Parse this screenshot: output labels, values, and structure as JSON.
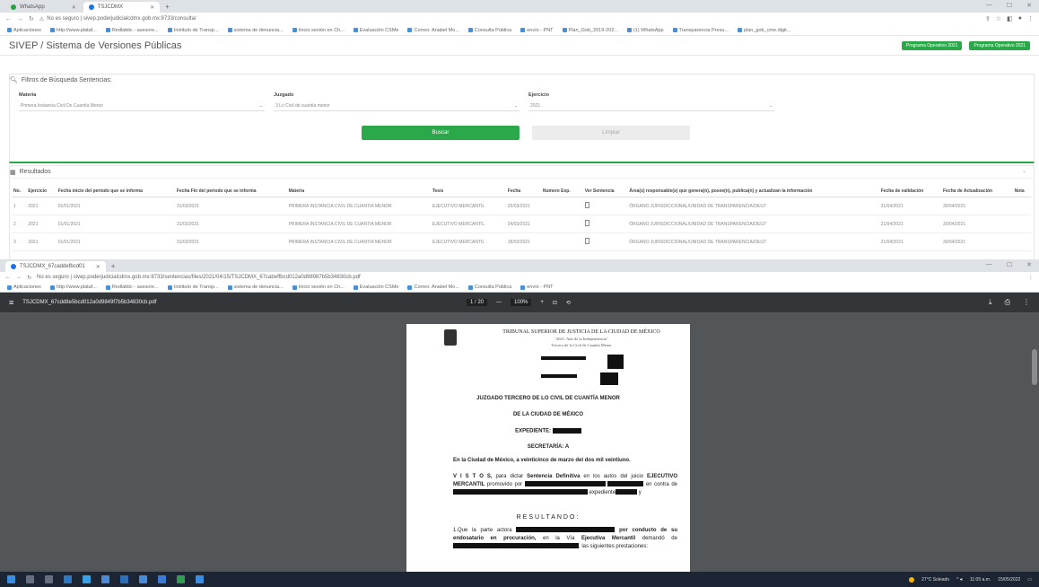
{
  "browser1": {
    "tabs": [
      {
        "label": "WhatsApp"
      },
      {
        "label": "TSJCDMX"
      }
    ],
    "url": "No es seguro | sivep.poderjudicialcdmx.gob.mx:8733/consulta/",
    "bookmarks": [
      "Aplicaciones",
      "http://www.plataf...",
      "Redlabtic - asesore...",
      "Instituto de Transp...",
      "sistema de denuncia...",
      "Inicio sesión en Ch...",
      "Evaluación CSMe",
      "Correo: Anabel Mo...",
      "Consulta Pública",
      "envío - PNT",
      "Plan_Gob_2019-202...",
      "(1) WhatsApp",
      "Transparencia Presu...",
      "plan_gob_cme.digit..."
    ]
  },
  "app": {
    "title": "SIVEP / Sistema de Versiones Públicas",
    "header_buttons": [
      "Programa Operativo 2021",
      "Programa Operativo 2021"
    ],
    "filters_title": "Filtros de Búsqueda Sentencias:",
    "fields": [
      {
        "label": "Materia",
        "value": "Primera Instancia Civil De Cuantía Menor"
      },
      {
        "label": "Juzgado",
        "value": "3 Lo Civil de cuantía menor"
      },
      {
        "label": "Ejercicio",
        "value": "2021"
      }
    ],
    "search_label": "Buscar",
    "clear_label": "Limpiar",
    "results_title": "Resultados",
    "columns": [
      "No.",
      "Ejercicio",
      "Fecha inicio del periodo que se informa",
      "Fecha Fin del periodo que se informa",
      "Materia",
      "Tesis",
      "Fecha",
      "Numero Exp.",
      "Ver Sentencia",
      "Área(s) responsable(s) que genera(n), posee(n), publica(n) y actualizan la información",
      "Fecha de validación",
      "Fecha de Actualización",
      "Nota"
    ],
    "rows": [
      [
        "1",
        "2021",
        "01/01/2021",
        "31/03/2021",
        "PRIMERA INSTANCIA CIVIL DE CUANTIA MENOR",
        "EJECUTIVO MERCANTIL",
        "25/03/2021",
        "",
        "",
        "ÓRGANO JURISDICCIONAL/UNIDAD DE TRANSPARENCIA/DEGT",
        "31/04/2021",
        "30/04/2021",
        ""
      ],
      [
        "2",
        "2021",
        "01/01/2021",
        "31/03/2021",
        "PRIMERA INSTANCIA CIVIL DE CUANTIA MENOR",
        "EJECUTIVO MERCANTIL",
        "24/03/2021",
        "",
        "",
        "ÓRGANO JURISDICCIONAL/UNIDAD DE TRANSPARENCIA/DEGT",
        "21/04/2021",
        "30/04/2021",
        ""
      ],
      [
        "3",
        "2021",
        "01/01/2021",
        "31/03/2021",
        "PRIMERA INSTANCIA CIVIL DE CUANTIA MENOR",
        "EJECUTIVO MERCANTIL",
        "18/03/2021",
        "",
        "",
        "ÓRGANO JURISDICCIONAL/UNIDAD DE TRANSPARENCIA/DEGT",
        "21/04/2021",
        "30/04/2021",
        ""
      ]
    ]
  },
  "browser2": {
    "tab_label": "TSJCDMX_67caddefbcd01",
    "url": "No es seguro | sivep.poderjudicialcdmx.gob.mx:8733/sentencias/files/2021/04/15/TSJCDMX_67cabeffbcd012a0d98987b5b34830cb.pdf",
    "pdf_name": "TSJCDMX_67cdd8e5bcd012a0d9849f7b5b34830cb.pdf",
    "page_indicator": "1 / 20",
    "zoom": "100%"
  },
  "document": {
    "court": "TRIBUNAL SUPERIOR DE JUSTICIA DE LA CIUDAD DE MÉXICO",
    "motto": "\"2021: Año de la Independencia\"",
    "court_sub": "Tercero de lo Civil de Cuantía Menor",
    "line1": "JUZGADO TERCERO DE LO CIVIL DE CUANTÍA MENOR",
    "line2": "DE LA CIUDAD DE MÉXICO",
    "expediente": "EXPEDIENTE:",
    "secretaria": "SECRETARÍA: A",
    "intro": "En la Ciudad de México, a veinticinco de marzo del dos mil veintiuno.",
    "vistos_a": "V I S T O S,",
    "vistos_b": " para dictar ",
    "vistos_c": "Sentencia Definitiva",
    "vistos_d": " en los autos del juicio ",
    "vistos_e": "EJECUTIVO MERCANTIL",
    "vistos_f": " promovido por",
    "vistos_g": "en contra de",
    "vistos_h": "expediente",
    "vistos_i": "y",
    "resultando": "RESULTANDO:",
    "r1_a": "1.Que la parte actora",
    "r1_b": "por conducto de su endosatario en procuración,",
    "r1_c": " en la Vía ",
    "r1_d": "Ejecutiva Mercantil",
    "r1_e": " demandó de",
    "r1_f": ", las siguientes prestaciones:"
  },
  "taskbar": {
    "weather": "27°C Soleado",
    "time": "11:05 a.m.",
    "date": "15/05/2022"
  }
}
